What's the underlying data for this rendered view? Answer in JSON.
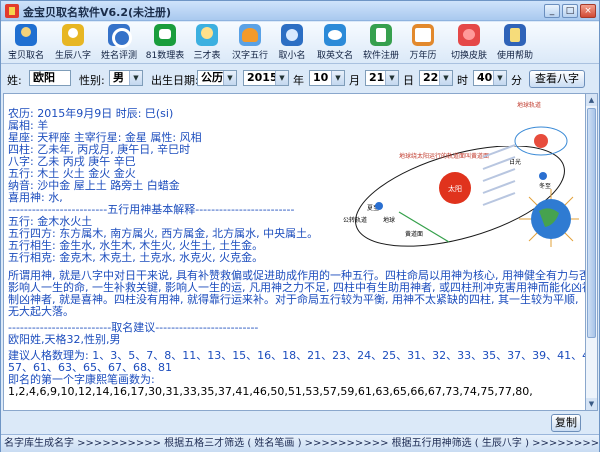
{
  "window": {
    "title": "金宝贝取名软件V6.2(未注册)"
  },
  "toolbar": {
    "items": [
      {
        "label": "宝贝取名",
        "icon": "baby-name-icon"
      },
      {
        "label": "生辰八字",
        "icon": "birth-chart-icon"
      },
      {
        "label": "姓名评测",
        "icon": "name-test-icon"
      },
      {
        "label": "81数理表",
        "icon": "numerology-table-icon"
      },
      {
        "label": "三才表",
        "icon": "three-talents-icon"
      },
      {
        "label": "汉字五行",
        "icon": "hanzi-elements-icon"
      },
      {
        "label": "取小名",
        "icon": "nickname-icon"
      },
      {
        "label": "取英文名",
        "icon": "english-name-icon"
      },
      {
        "label": "软件注册",
        "icon": "register-icon"
      },
      {
        "label": "万年历",
        "icon": "calendar-icon"
      },
      {
        "label": "切换皮肤",
        "icon": "skin-icon"
      },
      {
        "label": "使用帮助",
        "icon": "help-icon"
      }
    ]
  },
  "form": {
    "surname_label": "姓:",
    "surname": "欧阳",
    "gender_label": "性别:",
    "gender": "男",
    "birth_label": "出生日期:",
    "calendar_type": "公历",
    "year": "2015",
    "year_label": "年",
    "month": "10",
    "month_label": "月",
    "day": "21",
    "day_label": "日",
    "hour": "22",
    "hour_label": "时",
    "minute": "40",
    "minute_label": "分",
    "view_bazi_button": "查看八字"
  },
  "content": {
    "lines": [
      "农历: 2015年9月9日 时辰: 巳(si)",
      "属相: 羊",
      "星座: 天秤座   主宰行星: 金星  属性: 风相",
      "四柱: 乙未年, 丙戌月, 庚午日, 辛巳时",
      "八字: 乙未 丙戌 庚午 辛巳",
      "五行: 木土 火土 金火 金火",
      "纳音: 沙中金 屋上土 路旁土 白蜡金",
      "喜用神: 水,",
      "-------------------------五行用神基本解释-------------------------",
      "五行: 金木水火土",
      "五行四方: 东方属木, 南方属火, 西方属金, 北方属水, 中央属土。",
      "五行相生: 金生水, 水生木, 木生火, 火生土, 土生金。",
      "五行相克: 金克木, 木克土, 土克水, 水克火, 火克金。",
      "所谓用神, 就是八字中对日干来说, 具有补赞救偏或促进助成作用的一种五行。四柱命局以用神为核心, 用神健全有力与否,",
      "影响人一生的命, 一生补救关键, 影响人一生的运, 凡用神之力不足, 四柱中有生助用神者, 或四柱刑冲克害用神而能化凶神,",
      "制凶神者, 就是喜神。四柱没有用神, 就得靠行运来补。对于命局五行较为平衡, 用神不太紧缺的四柱, 其一生较为平顺,",
      "无大起大落。",
      "--------------------------取名建议--------------------------",
      "欧阳姓,天格32,性别,男",
      "建议人格数理为: 1、3、5、7、8、11、13、15、16、18、21、23、24、25、31、32、33、35、37、39、41、45、47、48、52、",
      "57、61、63、65、67、68、81",
      "即名的第一个字康熙笔画数为:",
      "1,2,4,6,9,10,12,14,16,17,30,31,33,35,37,41,46,50,51,53,57,59,61,63,65,66,67,73,74,75,77,80,"
    ]
  },
  "diagram": {
    "title": "地球绕太阳运行的轨道面叫黄道面",
    "sun": "太阳",
    "labels": [
      "日光",
      "地球",
      "黄道面",
      "公转轨道",
      "夏至",
      "冬至"
    ],
    "illustration_caption": "地球轨道"
  },
  "copy_button": "复制",
  "statusbar": {
    "text": "名字库生成名字 >>>>>>>>>> 根据五格三才筛选 ( 姓名笔画 ) >>>>>>>>>> 根据五行用神筛选 ( 生辰八字 ) >>>>>>>>>> 给出评分解释 >>>>>>>>>> 用户挑选"
  },
  "colors": {
    "content_text": "#1c4dbd",
    "window_bg": "#dbe9f8",
    "sun": "#e0331d"
  }
}
